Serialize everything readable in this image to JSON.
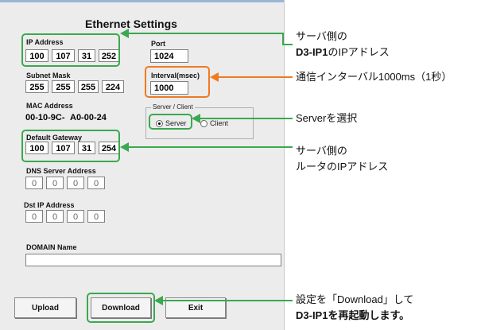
{
  "title": "Ethernet Settings",
  "ip": {
    "label": "IP Address",
    "octets": [
      "100",
      "107",
      "31",
      "252"
    ]
  },
  "subnet": {
    "label": "Subnet  Mask",
    "octets": [
      "255",
      "255",
      "255",
      "224"
    ]
  },
  "mac": {
    "label": "MAC Address",
    "part1": "00-10-9C-",
    "part2": "A0-00-24"
  },
  "gateway": {
    "label": "Default Gateway",
    "octets": [
      "100",
      "107",
      "31",
      "254"
    ]
  },
  "dns": {
    "label": "DNS Server Address",
    "octets": [
      "0",
      "0",
      "0",
      "0"
    ]
  },
  "dst": {
    "label": "Dst IP Address",
    "octets": [
      "0",
      "0",
      "0",
      "0"
    ]
  },
  "domain": {
    "label": "DOMAIN Name",
    "value": ""
  },
  "port": {
    "label": "Port",
    "value": "1024"
  },
  "interval": {
    "label": "Interval(msec)",
    "value": "1000"
  },
  "mode": {
    "group_label": "Server / Client",
    "server": "Server",
    "client": "Client",
    "selected": "Server"
  },
  "buttons": {
    "upload": "Upload",
    "download": "Download",
    "exit": "Exit"
  },
  "annotations": {
    "ip_line1": "サーバ側の",
    "ip_line2_bold": "D3-IP1",
    "ip_line2_rest": "のIPアドレス",
    "interval_note": "通信インターバル1000ms（1秒）",
    "server_note": "Serverを選択",
    "gw_line1": "サーバ側の",
    "gw_line2": "ルータのIPアドレス",
    "dl_line1": "設定を「Download」して",
    "dl_line2_bold": "D3-IP1",
    "dl_line2_rest": "を再起動します。"
  },
  "colors": {
    "highlight_green": "#3aa84f",
    "highlight_orange": "#ee7a22"
  }
}
